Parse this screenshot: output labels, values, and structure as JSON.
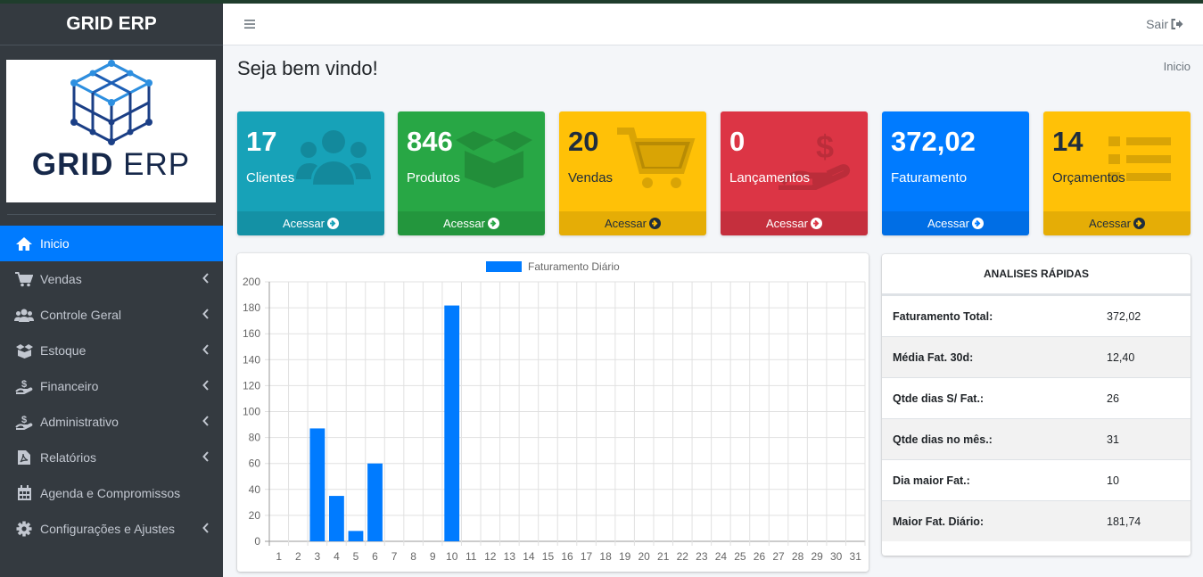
{
  "app": {
    "brand": "GRID ERP",
    "logo_text_bold": "GRID",
    "logo_text_thin": "ERP"
  },
  "sidebar": {
    "items": [
      {
        "label": "Inicio",
        "icon": "home-icon",
        "active": true,
        "chevron": false
      },
      {
        "label": "Vendas",
        "icon": "cart-icon",
        "active": false,
        "chevron": true
      },
      {
        "label": "Controle Geral",
        "icon": "users-icon",
        "active": false,
        "chevron": true
      },
      {
        "label": "Estoque",
        "icon": "box-icon",
        "active": false,
        "chevron": true
      },
      {
        "label": "Financeiro",
        "icon": "money-hand-icon",
        "active": false,
        "chevron": true
      },
      {
        "label": "Administrativo",
        "icon": "money-hand-icon",
        "active": false,
        "chevron": true
      },
      {
        "label": "Relatórios",
        "icon": "pdf-file-icon",
        "active": false,
        "chevron": true
      },
      {
        "label": "Agenda e Compromissos",
        "icon": "calendar-icon",
        "active": false,
        "chevron": false
      },
      {
        "label": "Configurações e Ajustes",
        "icon": "gear-icon",
        "active": false,
        "chevron": true
      }
    ]
  },
  "topbar": {
    "logout_label": "Sair"
  },
  "page": {
    "title": "Seja bem vindo!",
    "breadcrumb": "Inicio"
  },
  "boxes": [
    {
      "value": "17",
      "label": "Clientes",
      "link": "Acessar",
      "color": "#17a2b8",
      "icon": "users-icon"
    },
    {
      "value": "846",
      "label": "Produtos",
      "link": "Acessar",
      "color": "#28a745",
      "icon": "box-open-icon"
    },
    {
      "value": "20",
      "label": "Vendas",
      "link": "Acessar",
      "color": "#ffc107",
      "icon": "cart-icon"
    },
    {
      "value": "0",
      "label": "Lançamentos",
      "link": "Acessar",
      "color": "#dc3545",
      "icon": "money-hand-icon"
    },
    {
      "value": "372,02",
      "label": "Faturamento",
      "link": "Acessar",
      "color": "#007bff",
      "icon": "none"
    },
    {
      "value": "14",
      "label": "Orçamentos",
      "link": "Acessar",
      "color": "#ffc107",
      "icon": "list-icon"
    }
  ],
  "quick": {
    "title": "ANALISES RÁPIDAS",
    "rows": [
      {
        "k": "Faturamento Total:",
        "v": "372,02"
      },
      {
        "k": "Média Fat. 30d:",
        "v": "12,40"
      },
      {
        "k": "Qtde dias S/ Fat.:",
        "v": "26"
      },
      {
        "k": "Qtde dias no mês.:",
        "v": "31"
      },
      {
        "k": "Dia maior Fat.:",
        "v": "10"
      },
      {
        "k": "Maior Fat. Diário:",
        "v": "181,74"
      }
    ]
  },
  "chart_data": {
    "type": "bar",
    "categories": [
      "1",
      "2",
      "3",
      "4",
      "5",
      "6",
      "7",
      "8",
      "9",
      "10",
      "11",
      "12",
      "13",
      "14",
      "15",
      "16",
      "17",
      "18",
      "19",
      "20",
      "21",
      "22",
      "23",
      "24",
      "25",
      "26",
      "27",
      "28",
      "29",
      "30",
      "31"
    ],
    "series": [
      {
        "name": "Faturamento Diário",
        "color": "#007bff",
        "values": [
          0,
          0,
          87,
          35,
          8,
          60,
          0,
          0,
          0,
          181.74,
          0,
          0,
          0,
          0,
          0,
          0,
          0,
          0,
          0,
          0,
          0,
          0,
          0,
          0,
          0,
          0,
          0,
          0,
          0,
          0,
          0
        ]
      }
    ],
    "ylim": [
      0,
      200
    ],
    "yticks": [
      0,
      20,
      40,
      60,
      80,
      100,
      120,
      140,
      160,
      180,
      200
    ],
    "grid": true,
    "legend": "top"
  }
}
